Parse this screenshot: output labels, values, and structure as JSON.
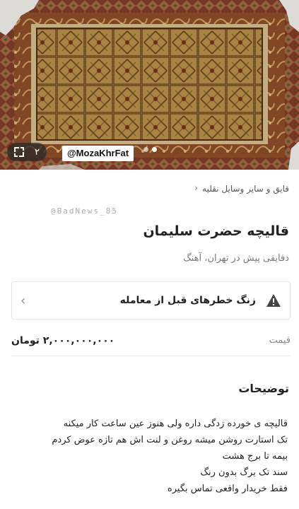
{
  "hero": {
    "image_counter": "۲",
    "watermark": "@MozaKhrFat",
    "dots_count": 2
  },
  "listing": {
    "breadcrumb": "قایق و سایر وسایل نقلیه",
    "overlay_watermark": "@BadNews_85",
    "title": "قالیچه حضرت سلیمان",
    "subtitle": "دقایقی پیش در تهران، آهنگ",
    "warning_label": "زنگ خطرهای قبل از معامله",
    "price_label": "قیمت",
    "price_value": "۲,۰۰۰,۰۰۰,۰۰۰ تومان",
    "description_title": "توضیحات",
    "description_lines": [
      "قالیچه ی خورده زدگی داره ولی هنوز عین ساعت کار میکنه",
      "تک استارت روشن میشه روغن و لنت اش هم تازه عوض کردم",
      "بیمه تا برج هشت",
      "سند تک برگ بدون رنگ",
      "فقط خریدار واقعی تماس بگیره"
    ]
  },
  "colors": {
    "warning_icon": "#444444",
    "carpet_field": "#b58a3a",
    "carpet_border": "#7a3a2a"
  },
  "icons": {
    "expand": "expand-icon",
    "warning": "warning-icon",
    "chevron_left": "chevron-left-icon"
  }
}
